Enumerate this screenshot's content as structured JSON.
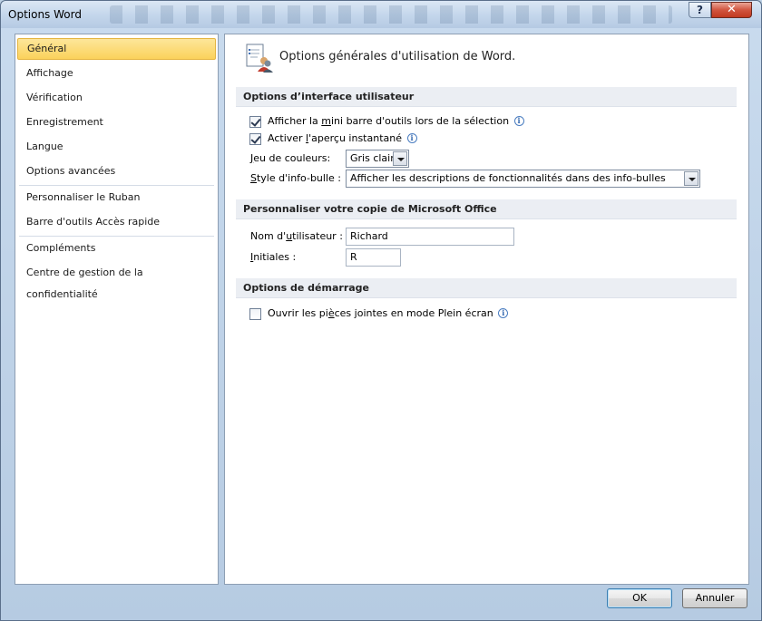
{
  "window": {
    "title": "Options Word",
    "help_label": "?",
    "close_label": "✕"
  },
  "sidebar": {
    "items": [
      {
        "label": "Général",
        "selected": true
      },
      {
        "label": "Affichage"
      },
      {
        "label": "Vérification"
      },
      {
        "label": "Enregistrement"
      },
      {
        "label": "Langue"
      },
      {
        "label": "Options avancées"
      },
      {
        "label": "Personnaliser le Ruban"
      },
      {
        "label": "Barre d'outils Accès rapide"
      },
      {
        "label": "Compléments"
      },
      {
        "label": "Centre de gestion de la confidentialité"
      }
    ]
  },
  "content": {
    "header_icon": "general-options-icon",
    "header_title": "Options générales d'utilisation de Word.",
    "sections": {
      "ui": {
        "title": "Options d’interface utilisateur",
        "mini_toolbar": {
          "pre": "Afficher la ",
          "u": "m",
          "post": "ini barre d'outils lors de la sélection",
          "checked": true
        },
        "live_preview": {
          "pre": "Activer ",
          "u": "l",
          "post": "'aperçu instantané",
          "checked": true
        },
        "color_scheme": {
          "u": "J",
          "post": "eu de couleurs:",
          "value": "Gris clair"
        },
        "tooltip_style": {
          "u": "S",
          "post": "tyle d'info-bulle :",
          "value": "Afficher les descriptions de fonctionnalités dans des info-bulles"
        }
      },
      "personalize": {
        "title": "Personnaliser votre copie de Microsoft Office",
        "username": {
          "pre": "Nom d'",
          "u": "u",
          "post": "tilisateur :",
          "value": "Richard"
        },
        "initials": {
          "u": "I",
          "post": "nitiales :",
          "value": "R"
        }
      },
      "startup": {
        "title": "Options de démarrage",
        "fullscreen": {
          "pre": "Ouvrir les pi",
          "u": "è",
          "post": "ces jointes en mode Plein écran",
          "checked": false
        }
      }
    },
    "info_glyph": "i"
  },
  "footer": {
    "ok_label": "OK",
    "cancel_label": "Annuler"
  },
  "colors": {
    "selected_nav": "#fbd25b",
    "section_bg": "#ebeef3",
    "close_button": "#c1391f"
  }
}
